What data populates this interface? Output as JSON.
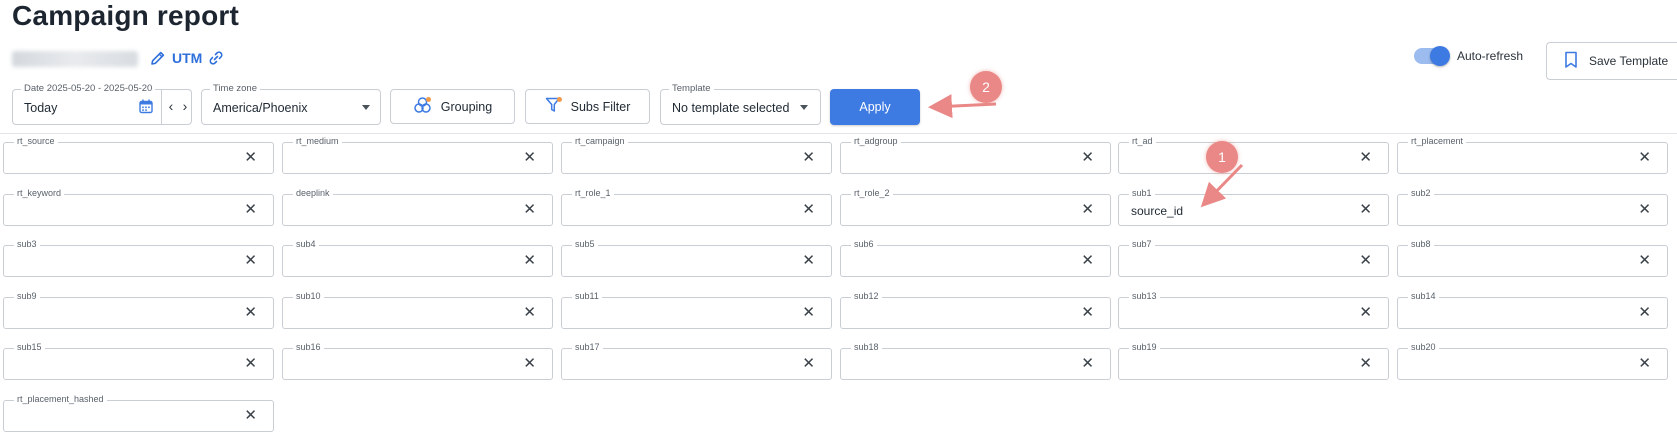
{
  "header": {
    "title": "Campaign report",
    "utm_label": "UTM",
    "auto_refresh_label": "Auto-refresh",
    "auto_refresh_on": true,
    "save_template_label": "Save Template"
  },
  "toolbar": {
    "date": {
      "label": "Date 2025-05-20 - 2025-05-20",
      "value": "Today"
    },
    "timezone": {
      "label": "Time zone",
      "value": "America/Phoenix"
    },
    "grouping_label": "Grouping",
    "subs_filter_label": "Subs Filter",
    "template": {
      "label": "Template",
      "value": "No template selected"
    },
    "apply_label": "Apply"
  },
  "utm_fields": [
    {
      "label": "rt_source",
      "value": ""
    },
    {
      "label": "rt_medium",
      "value": ""
    },
    {
      "label": "rt_campaign",
      "value": ""
    },
    {
      "label": "rt_adgroup",
      "value": ""
    },
    {
      "label": "rt_ad",
      "value": ""
    },
    {
      "label": "rt_placement",
      "value": ""
    },
    {
      "label": "rt_keyword",
      "value": ""
    },
    {
      "label": "deeplink",
      "value": ""
    },
    {
      "label": "rt_role_1",
      "value": ""
    },
    {
      "label": "rt_role_2",
      "value": ""
    },
    {
      "label": "sub1",
      "value": "source_id"
    },
    {
      "label": "sub2",
      "value": ""
    },
    {
      "label": "sub3",
      "value": ""
    },
    {
      "label": "sub4",
      "value": ""
    },
    {
      "label": "sub5",
      "value": ""
    },
    {
      "label": "sub6",
      "value": ""
    },
    {
      "label": "sub7",
      "value": ""
    },
    {
      "label": "sub8",
      "value": ""
    },
    {
      "label": "sub9",
      "value": ""
    },
    {
      "label": "sub10",
      "value": ""
    },
    {
      "label": "sub11",
      "value": ""
    },
    {
      "label": "sub12",
      "value": ""
    },
    {
      "label": "sub13",
      "value": ""
    },
    {
      "label": "sub14",
      "value": ""
    },
    {
      "label": "sub15",
      "value": ""
    },
    {
      "label": "sub16",
      "value": ""
    },
    {
      "label": "sub17",
      "value": ""
    },
    {
      "label": "sub18",
      "value": ""
    },
    {
      "label": "sub19",
      "value": ""
    },
    {
      "label": "sub20",
      "value": ""
    },
    {
      "label": "rt_placement_hashed",
      "value": ""
    }
  ],
  "clear_glyph": "✕",
  "annotations": [
    {
      "number": "1",
      "points_to": "sub1"
    },
    {
      "number": "2",
      "points_to": "Apply"
    }
  ],
  "colors": {
    "accent": "#3d7be2",
    "annotation": "#e98886",
    "link": "#2f6fdb"
  }
}
